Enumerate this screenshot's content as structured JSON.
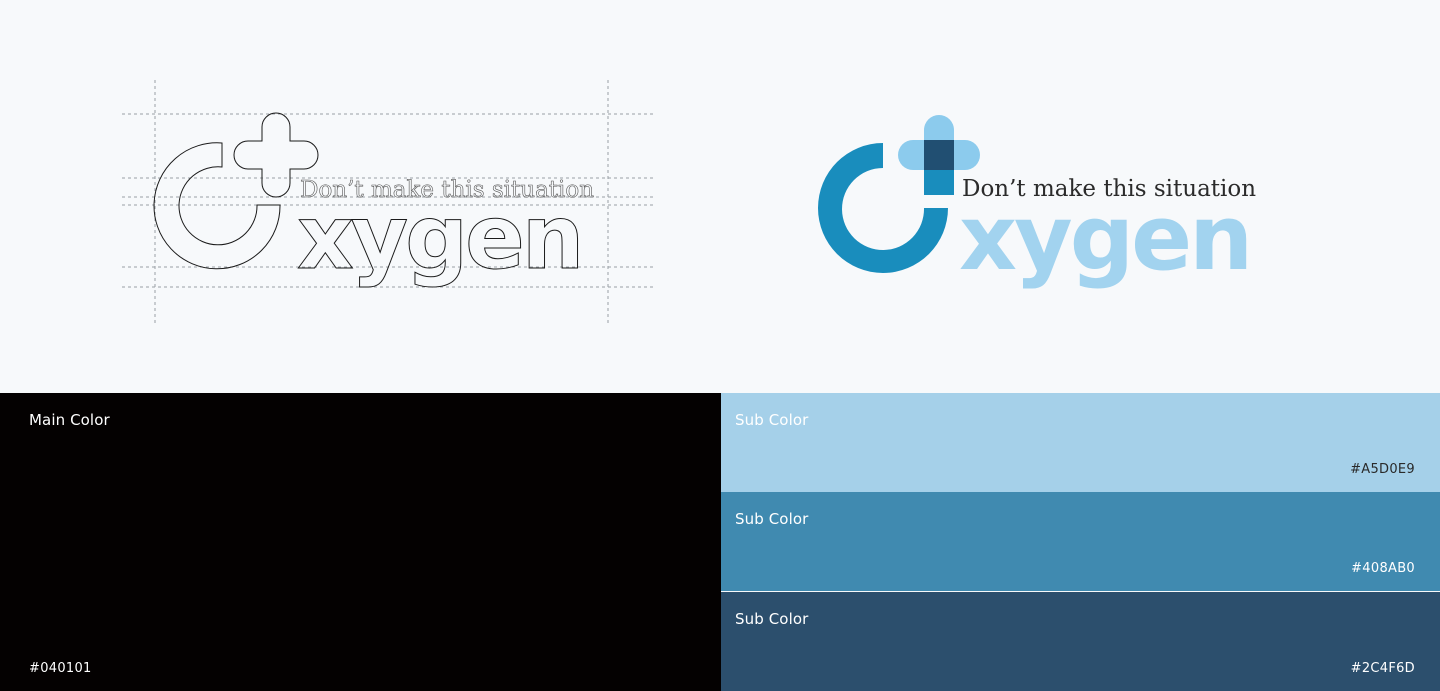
{
  "logo": {
    "tagline": "Don’t make this situation",
    "wordmark": "xygen"
  },
  "palette": {
    "main": {
      "label": "Main Color",
      "hex": "#040101"
    },
    "subs": [
      {
        "label": "Sub Color",
        "hex": "#A5D0E9"
      },
      {
        "label": "Sub Color",
        "hex": "#408AB0"
      },
      {
        "label": "Sub Color",
        "hex": "#2C4F6D"
      }
    ]
  },
  "colors": {
    "background": "#f7f9fb",
    "ring": "#198dbd",
    "wordmark": "#a2d3ef",
    "cross_light": "#8ccbed",
    "cross_dark": "#214f72"
  }
}
